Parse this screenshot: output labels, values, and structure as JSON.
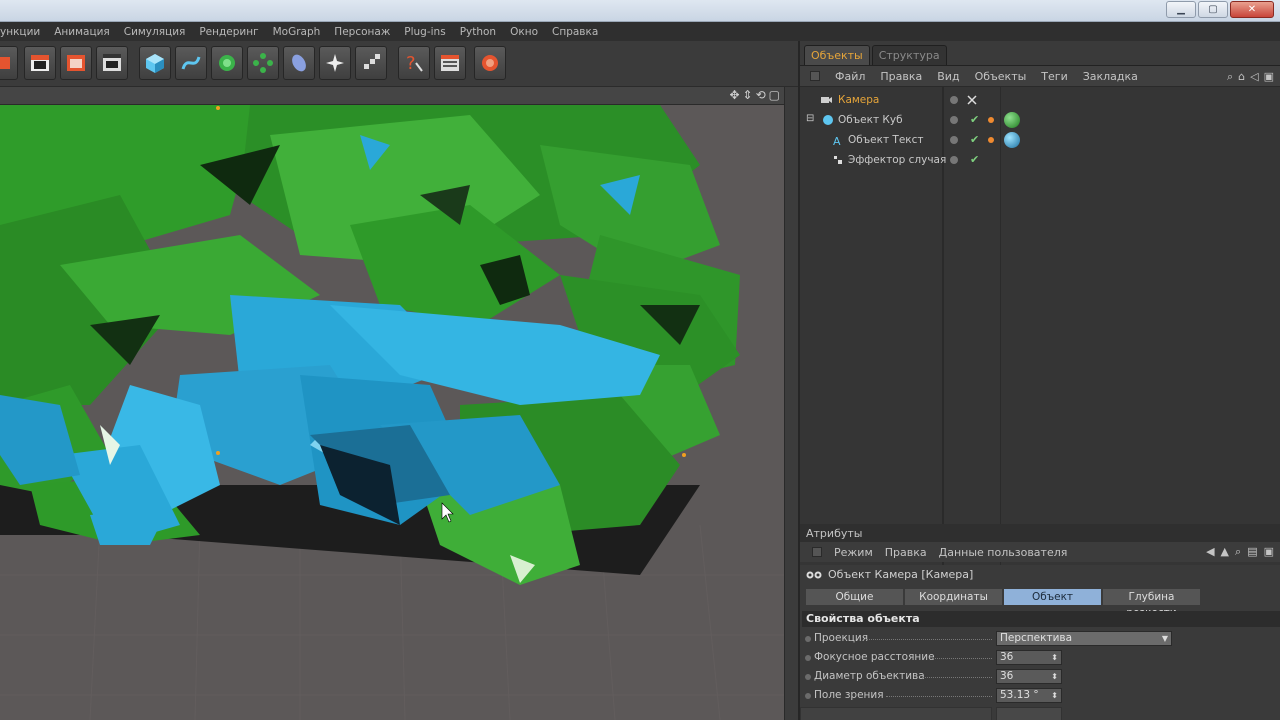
{
  "window": {
    "min": "▁",
    "max": "▢",
    "close": "✕"
  },
  "menubar": [
    "ункции",
    "Анимация",
    "Симуляция",
    "Рендеринг",
    "MoGraph",
    "Персонаж",
    "Plug-ins",
    "Python",
    "Окно",
    "Справка"
  ],
  "toolbar_icons": [
    "render-region-icon",
    "clapboard-icon",
    "render-view-icon",
    "render-settings-icon",
    "cube-icon",
    "spline-icon",
    "nurbs-icon",
    "array-icon",
    "deformer-icon",
    "scene-icon",
    "cloner-icon",
    "help-icon",
    "layout-icon",
    "record-icon"
  ],
  "viewport": {
    "nav_icons": [
      "✥",
      "⇕",
      "⟲",
      "▢"
    ],
    "colors": {
      "bg": "#5c5858",
      "green": "#2e9b2a",
      "blue": "#2aa8d8",
      "dark": "#123012"
    }
  },
  "object_manager": {
    "tabs": [
      "Объекты",
      "Структура"
    ],
    "menu": [
      "Файл",
      "Правка",
      "Вид",
      "Объекты",
      "Теги",
      "Закладка"
    ],
    "tools": [
      "⌕",
      "⌂",
      "◁",
      "▣"
    ],
    "rows": [
      {
        "name": "Камера",
        "selected": true,
        "indent": 0
      },
      {
        "name": "Объект Куб",
        "selected": false,
        "indent": 0
      },
      {
        "name": "Объект Текст",
        "selected": false,
        "indent": 1
      },
      {
        "name": "Эффектор случая",
        "selected": false,
        "indent": 1
      }
    ]
  },
  "attributes": {
    "title": "Атрибуты",
    "menu": [
      "Режим",
      "Правка",
      "Данные пользователя"
    ],
    "object_line": "Объект Камера [Камера]",
    "tabs": [
      "Общие",
      "Координаты",
      "Объект",
      "Глубина резкости"
    ],
    "active_tab": "Объект",
    "section": "Свойства объекта",
    "props": [
      {
        "label": "Проекция",
        "value": "Перспектива",
        "kind": "drop"
      },
      {
        "label": "Фокусное расстояние",
        "value": "36",
        "kind": "num"
      },
      {
        "label": "Диаметр объектива",
        "value": "36",
        "kind": "num"
      },
      {
        "label": "Поле зрения",
        "value": "53.13 °",
        "kind": "num"
      }
    ]
  }
}
